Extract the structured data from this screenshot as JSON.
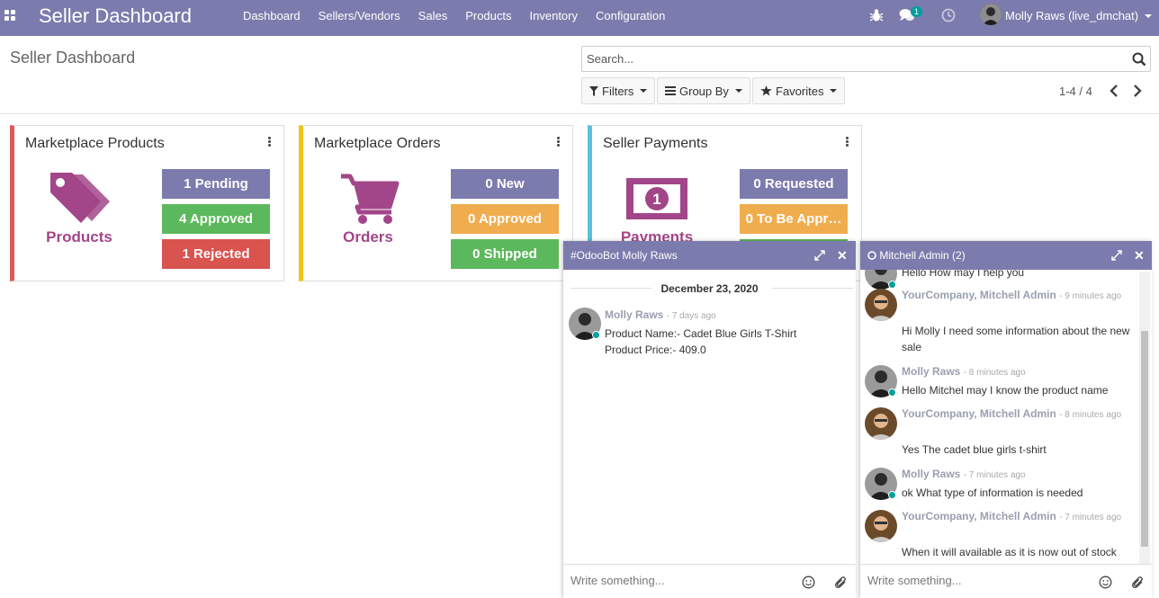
{
  "navbar": {
    "brand": "Seller Dashboard",
    "menu": [
      "Dashboard",
      "Sellers/Vendors",
      "Sales",
      "Products",
      "Inventory",
      "Configuration"
    ],
    "chat_badge": "1",
    "user": "Molly Raws (live_dmchat)",
    "colors": {
      "bar": "#7c7bad"
    }
  },
  "control_panel": {
    "title": "Seller Dashboard",
    "search_placeholder": "Search...",
    "filters": "Filters",
    "group_by": "Group By",
    "favorites": "Favorites",
    "pager": "1-4 / 4"
  },
  "cards": [
    {
      "title": "Marketplace Products",
      "label": "Products",
      "icon": "tags-icon",
      "border": "#dc5a5a",
      "stats": [
        {
          "text": "1 Pending",
          "color": "#7c7bad"
        },
        {
          "text": "4 Approved",
          "color": "#5cb85c"
        },
        {
          "text": "1 Rejected",
          "color": "#d9534f"
        }
      ]
    },
    {
      "title": "Marketplace Orders",
      "label": "Orders",
      "icon": "cart-icon",
      "border": "#f0c419",
      "stats": [
        {
          "text": "0 New",
          "color": "#7c7bad"
        },
        {
          "text": "0 Approved",
          "color": "#f0ad4e"
        },
        {
          "text": "0 Shipped",
          "color": "#5cb85c"
        }
      ]
    },
    {
      "title": "Seller Payments",
      "label": "Payments",
      "icon": "money-icon",
      "border": "#5bc0de",
      "stats": [
        {
          "text": "0 Requested",
          "color": "#7c7bad"
        },
        {
          "text": "0 To Be Appr…",
          "color": "#f0ad4e"
        }
      ]
    }
  ],
  "chat_left": {
    "title": "#OdooBot Molly Raws",
    "date": "December 23, 2020",
    "message": {
      "author": "Molly Raws",
      "time": "- 7 days ago",
      "line1": "Product Name:- Cadet Blue Girls T-Shirt",
      "line2": "Product Price:- 409.0"
    },
    "composer_placeholder": "Write something..."
  },
  "chat_right": {
    "title": "Mitchell Admin (2)",
    "partial_top": "Hello How may I help you",
    "messages": [
      {
        "author": "YourCompany, Mitchell Admin",
        "time": "- 9 minutes ago",
        "text": "Hi Molly I need some information about the new sale",
        "who": "admin"
      },
      {
        "author": "Molly Raws",
        "time": "- 8 minutes ago",
        "text": "Hello Mitchel may I know the product name",
        "who": "molly"
      },
      {
        "author": "YourCompany, Mitchell Admin",
        "time": "- 8 minutes ago",
        "text": "Yes The cadet blue girls t-shirt",
        "who": "admin"
      },
      {
        "author": "Molly Raws",
        "time": "- 7 minutes ago",
        "text": "ok What type of information is needed",
        "who": "molly"
      },
      {
        "author": "YourCompany, Mitchell Admin",
        "time": "- 7 minutes ago",
        "text": "When it will available as it is now out of stock",
        "who": "admin"
      }
    ],
    "composer_placeholder": "Write something..."
  }
}
